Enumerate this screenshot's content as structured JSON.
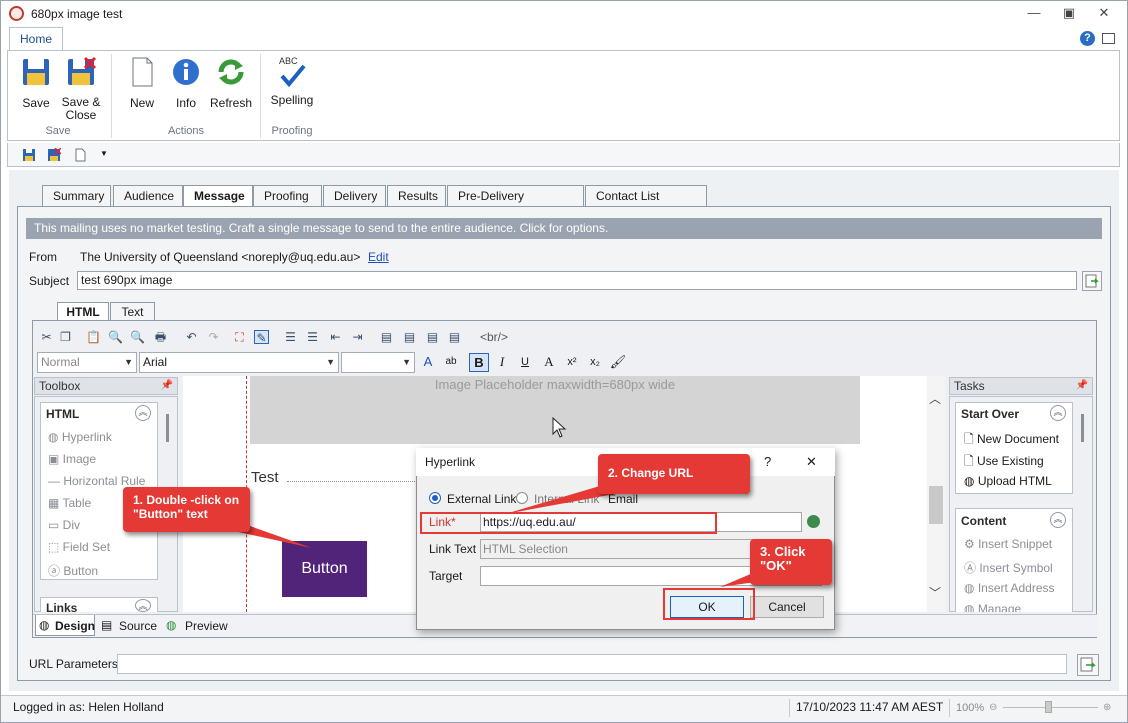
{
  "window": {
    "title": "680px image test"
  },
  "ribbon": {
    "tab": "Home",
    "buttons": {
      "save": "Save",
      "save_close_1": "Save &",
      "save_close_2": "Close",
      "new": "New",
      "info": "Info",
      "refresh": "Refresh",
      "spelling": "Spelling",
      "spelling_abc": "ABC"
    },
    "groups": {
      "save": "Save",
      "actions": "Actions",
      "proofing": "Proofing"
    }
  },
  "tabs": [
    "Summary",
    "Audience",
    "Message",
    "Proofing",
    "Delivery",
    "Results",
    "Pre-Delivery Checklist",
    "Contact List Import"
  ],
  "message": {
    "info_bar": "This mailing uses no market testing. Craft a single message to send to the entire audience. Click for options.",
    "from_label": "From",
    "from_value": "The University of Queensland <noreply@uq.edu.au>",
    "edit_link": "Edit",
    "subject_label": "Subject",
    "subject_value": "test 690px image",
    "editor_tabs": [
      "HTML",
      "Text"
    ],
    "br_tag": "<br/>",
    "style_combo": "Normal",
    "font_combo": "Arial",
    "size_combo": ""
  },
  "toolbox": {
    "title": "Toolbox",
    "html_group": "HTML",
    "items": [
      "Hyperlink",
      "Image",
      "Horizontal Rule",
      "Table",
      "Div",
      "Field Set",
      "Button"
    ],
    "links_group": "Links"
  },
  "tasks": {
    "title": "Tasks",
    "start_over": "Start Over",
    "start_items": [
      "New Document",
      "Use Existing",
      "Upload HTML"
    ],
    "content": "Content",
    "content_items": [
      "Insert Snippet",
      "Insert Symbol",
      "Insert Address",
      "Manage"
    ]
  },
  "design": {
    "placeholder_text": "Image Placeholder maxwidth=680px wide",
    "test_text": "Test",
    "button_text": "Button"
  },
  "view_tabs": [
    "Design",
    "Source",
    "Preview"
  ],
  "url_params_label": "URL Parameters",
  "status": {
    "user": "Logged in as: Helen Holland",
    "datetime": "17/10/2023 11:47 AM AEST",
    "zoom": "100%"
  },
  "dialog": {
    "title": "Hyperlink",
    "help": "?",
    "close": "✕",
    "radio_external": "External Link",
    "radio_internal": "Internal Link",
    "radio_email": "Email",
    "link_label": "Link*",
    "link_value": "https://uq.edu.au/",
    "link_text_label": "Link Text",
    "link_text_value": "HTML Selection",
    "target_label": "Target",
    "ok": "OK",
    "cancel": "Cancel"
  },
  "callouts": {
    "step1_line1": "1. Double -click on",
    "step1_line2": "\"Button\" text",
    "step2": "2. Change URL",
    "step3_line1": "3. Click",
    "step3_line2": "\"OK\""
  },
  "colors": {
    "accent_purple": "#51247a",
    "callout_red": "#e53935",
    "info_bar": "#9aa4b1"
  }
}
